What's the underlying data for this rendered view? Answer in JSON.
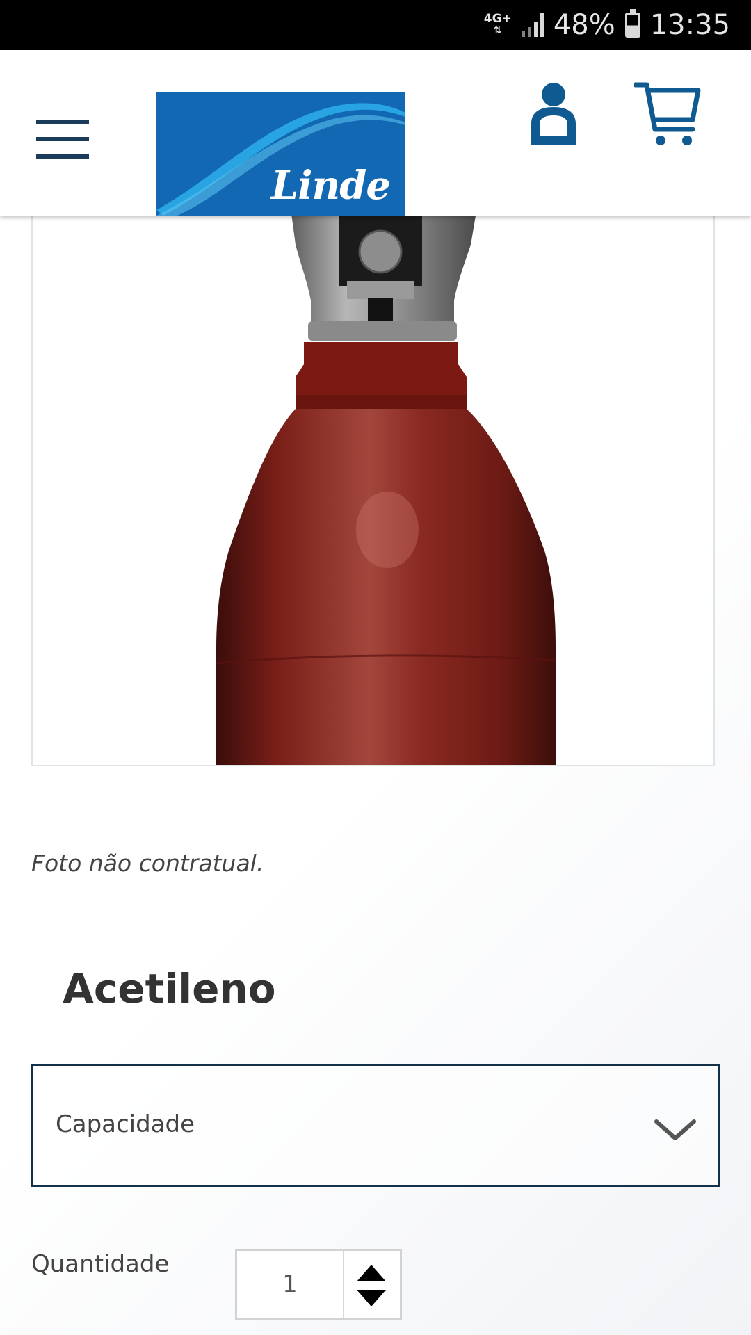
{
  "status_bar": {
    "network": "4G+",
    "battery": "48%",
    "time": "13:35"
  },
  "header": {
    "logo_text": "Linde"
  },
  "product": {
    "photo_note": "Foto não contratual.",
    "title": "Acetileno",
    "capacity_label": "Capacidade",
    "quantity_label": "Quantidade",
    "quantity_value": "1"
  },
  "colors": {
    "brand_blue": "#1268b3",
    "header_icon": "#0e5a91",
    "cylinder_red": "#8e2a22",
    "select_border": "#13324a"
  },
  "icons": {
    "menu": "hamburger-icon",
    "account": "user-icon",
    "cart": "cart-icon",
    "dropdown": "chevron-down-icon",
    "increment": "triangle-up-icon",
    "decrement": "triangle-down-icon"
  }
}
